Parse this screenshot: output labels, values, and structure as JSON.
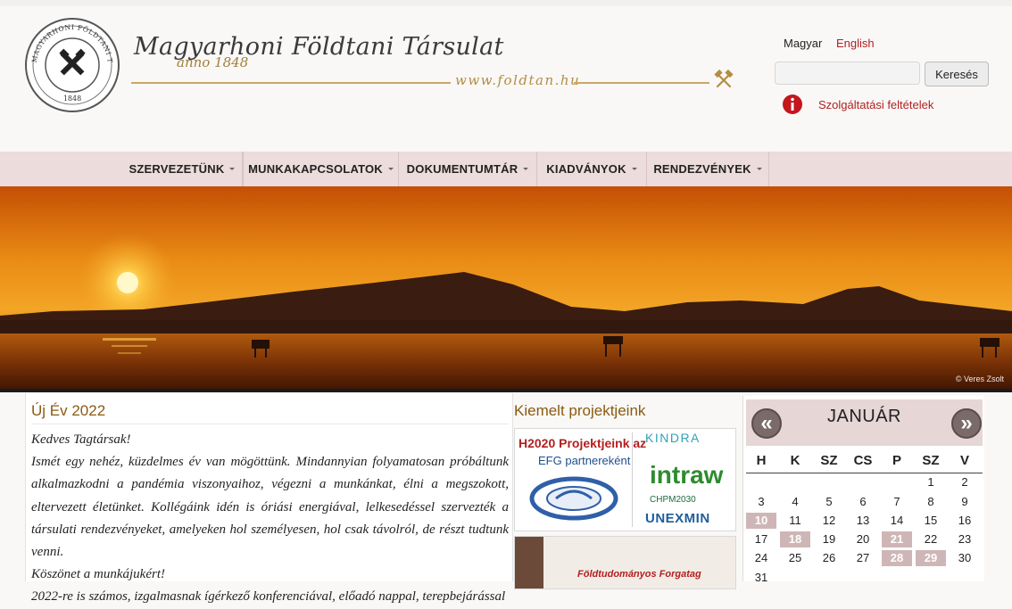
{
  "logo": {
    "title": "Magyarhoni Földtani Társulat",
    "anno": "anno 1848",
    "url": "www.foldtan.hu",
    "seal_top": "MAGYARHONI FÖLDTANI TÁRSULAT",
    "seal_motto": "MENTE ET MALLEO",
    "seal_year": "1848"
  },
  "lang": {
    "hu": "Magyar",
    "en": "English"
  },
  "search": {
    "button": "Keresés",
    "placeholder": ""
  },
  "terms": "Szolgáltatási feltételek",
  "nav": [
    "SZERVEZETÜNK",
    "MUNKAKAPCSOLATOK",
    "DOKUMENTUMTÁR",
    "KIADVÁNYOK",
    "RENDEZVÉNYEK"
  ],
  "hero": {
    "credit": "© Veres Zsolt"
  },
  "article": {
    "title": "Új Év 2022",
    "paragraphs": [
      "Kedves Tagtársak!",
      "Ismét egy nehéz, küzdelmes év van mögöttünk. Mindannyian folyamatosan próbáltunk alkalmazkodni a pandémia viszonyaihoz, végezni a munkánkat, élni a megszokott, eltervezett életünket. Kollégáink idén is óriási energiával, lelkesedéssel szervezték a társulati rendezvényeket, amelyeken hol személyesen, hol csak távolról, de részt tudtunk venni.",
      "Köszönet a munkájukért!",
      "2022-re is számos, izgalmasnak ígérkező konferenciával, előadó nappal, terepbejárással"
    ]
  },
  "projects": {
    "title": "Kiemelt projektjeink",
    "card1": {
      "line1": "H2020 Projektjeink az",
      "line2": "EFG partnereként",
      "kindra": "KINDRA",
      "intraw": "intraw",
      "chpm": "CHPM2030",
      "unexmin": "UNEXMIN"
    },
    "card2": {
      "text": "Földtudományos Forgatag"
    }
  },
  "calendar": {
    "month": "JANUÁR",
    "prev": "«",
    "next": "»",
    "dow": [
      "H",
      "K",
      "SZ",
      "CS",
      "P",
      "SZ",
      "V"
    ],
    "weeks": [
      [
        "",
        "",
        "",
        "",
        "",
        "1",
        "2"
      ],
      [
        "3",
        "4",
        "5",
        "6",
        "7",
        "8",
        "9"
      ],
      [
        "10",
        "11",
        "12",
        "13",
        "14",
        "15",
        "16"
      ],
      [
        "17",
        "18",
        "19",
        "20",
        "21",
        "22",
        "23"
      ],
      [
        "24",
        "25",
        "26",
        "27",
        "28",
        "29",
        "30"
      ],
      [
        "31",
        "",
        "",
        "",
        "",
        "",
        ""
      ]
    ],
    "event_days": [
      "10",
      "18",
      "21",
      "28",
      "29"
    ]
  },
  "colors": {
    "accent": "#8a5a12",
    "link": "#b21f1f",
    "nav_bg": "#ecdcdc",
    "gold": "#c9a963"
  }
}
